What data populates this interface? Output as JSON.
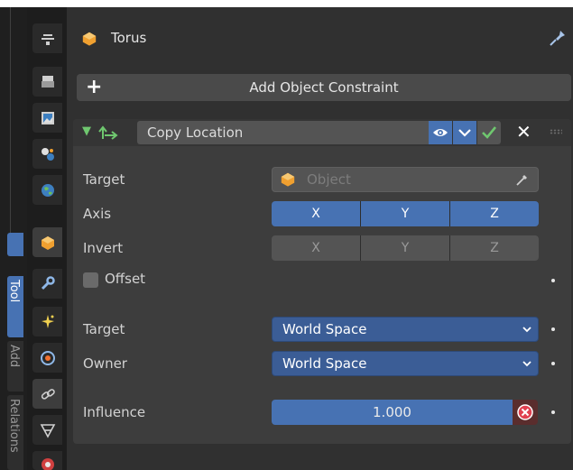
{
  "object": {
    "name": "Torus"
  },
  "add_constraint": {
    "label": "Add Object Constraint"
  },
  "constraint": {
    "name": "Copy Location",
    "target": {
      "label": "Target",
      "placeholder": "Object"
    },
    "axis": {
      "label": "Axis",
      "buttons": [
        "X",
        "Y",
        "Z"
      ]
    },
    "invert": {
      "label": "Invert",
      "buttons": [
        "X",
        "Y",
        "Z"
      ]
    },
    "offset": {
      "label": "Offset",
      "checked": false
    },
    "target_space": {
      "label": "Target",
      "value": "World Space"
    },
    "owner_space": {
      "label": "Owner",
      "value": "World Space"
    },
    "influence": {
      "label": "Influence",
      "value": "1.000"
    }
  },
  "sidebar_tabs": [
    "Tool",
    "Add",
    "Relations"
  ],
  "colors": {
    "accent": "#4772b3",
    "dropdown": "#3b5d96",
    "enabled_check": "#6fc76f",
    "object_orange": "#f0a030"
  }
}
